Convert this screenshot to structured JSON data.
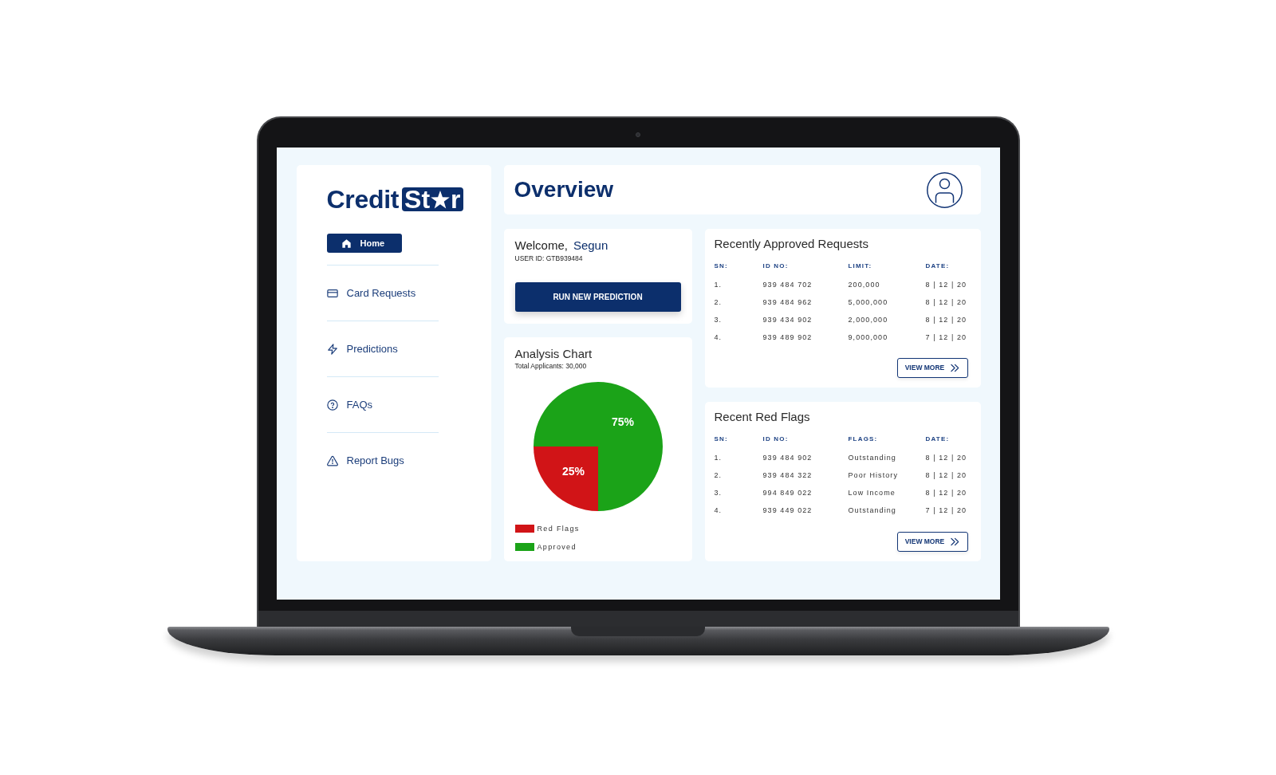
{
  "sidebar": {
    "logo": {
      "text": "Credit",
      "badge_text_before_star": "St",
      "badge_text_after_star": "r"
    },
    "nav_items": [
      {
        "label": "Home",
        "selected": true
      },
      {
        "label": "Card Requests",
        "selected": false
      },
      {
        "label": "Predictions",
        "selected": false
      },
      {
        "label": "FAQs",
        "selected": false
      },
      {
        "label": "Report Bugs",
        "selected": false
      }
    ]
  },
  "header": {
    "title": "Overview"
  },
  "welcome_card": {
    "greeting": "Welcome,",
    "user_name": "Segun",
    "user_id": "USER ID: GTB939484",
    "button": "RUN NEW PREDICTION"
  },
  "analysis_chart": {
    "title": "Analysis Chart",
    "subtitle": "Total Applicants: 30,000",
    "chart_data": {
      "type": "pie",
      "values": [
        25,
        75
      ],
      "value_labels": [
        "25%",
        "75%"
      ]
    },
    "legend": [
      {
        "label": "Red Flags",
        "color": "#d11417"
      },
      {
        "label": "Approved",
        "color": "#1ba318"
      }
    ]
  },
  "approved_requests": {
    "title": "Recently Approved Requests",
    "columns": [
      "SN:",
      "ID NO:",
      "LIMIT:",
      "DATE:"
    ],
    "rows": [
      [
        "1.",
        "939 484 702",
        "200,000",
        "8 | 12 | 20"
      ],
      [
        "2.",
        "939 484 962",
        "5,000,000",
        "8 | 12 | 20"
      ],
      [
        "3.",
        "939 434 902",
        "2,000,000",
        "8 | 12 | 20"
      ],
      [
        "4.",
        "939 489 902",
        "9,000,000",
        "7 | 12 | 20"
      ]
    ],
    "view_more": "VIEW MORE"
  },
  "red_flags": {
    "title": "Recent Red Flags",
    "columns": [
      "SN:",
      "ID NO:",
      "FLAGS:",
      "DATE:"
    ],
    "rows": [
      [
        "1.",
        "939 484 902",
        "Outstanding",
        "8 | 12 | 20"
      ],
      [
        "2.",
        "939 484 322",
        "Poor History",
        "8 | 12 | 20"
      ],
      [
        "3.",
        "994 849 022",
        "Low Income",
        "8 | 12 | 20"
      ],
      [
        "4.",
        "939 449 022",
        "Outstanding",
        "7 | 12 | 20"
      ]
    ],
    "view_more": "VIEW MORE"
  }
}
